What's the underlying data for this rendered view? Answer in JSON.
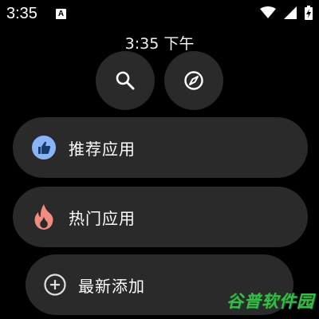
{
  "status_bar": {
    "time": "3:35",
    "notification_icon": "a-letter-icon",
    "notification_letter": "A",
    "icons": [
      "wifi-icon",
      "signal-icon",
      "battery-charging-icon"
    ]
  },
  "clock": {
    "text": "3:35 下午"
  },
  "quick_buttons": [
    {
      "icon": "search-icon"
    },
    {
      "icon": "compass-icon"
    }
  ],
  "menu": [
    {
      "label": "推荐应用",
      "icon": "thumbs-up-icon",
      "icon_color": "#8ab4f8"
    },
    {
      "label": "热门应用",
      "icon": "flame-icon",
      "icon_color": "#f28b82"
    },
    {
      "label": "最新添加",
      "icon": "plus-circle-icon",
      "icon_color": "#e0e0e0"
    }
  ],
  "watermark": "谷普软件园",
  "colors": {
    "background": "#000000",
    "surface": "#2a2a2a",
    "text": "#ffffff",
    "watermark": "#3db84a"
  }
}
